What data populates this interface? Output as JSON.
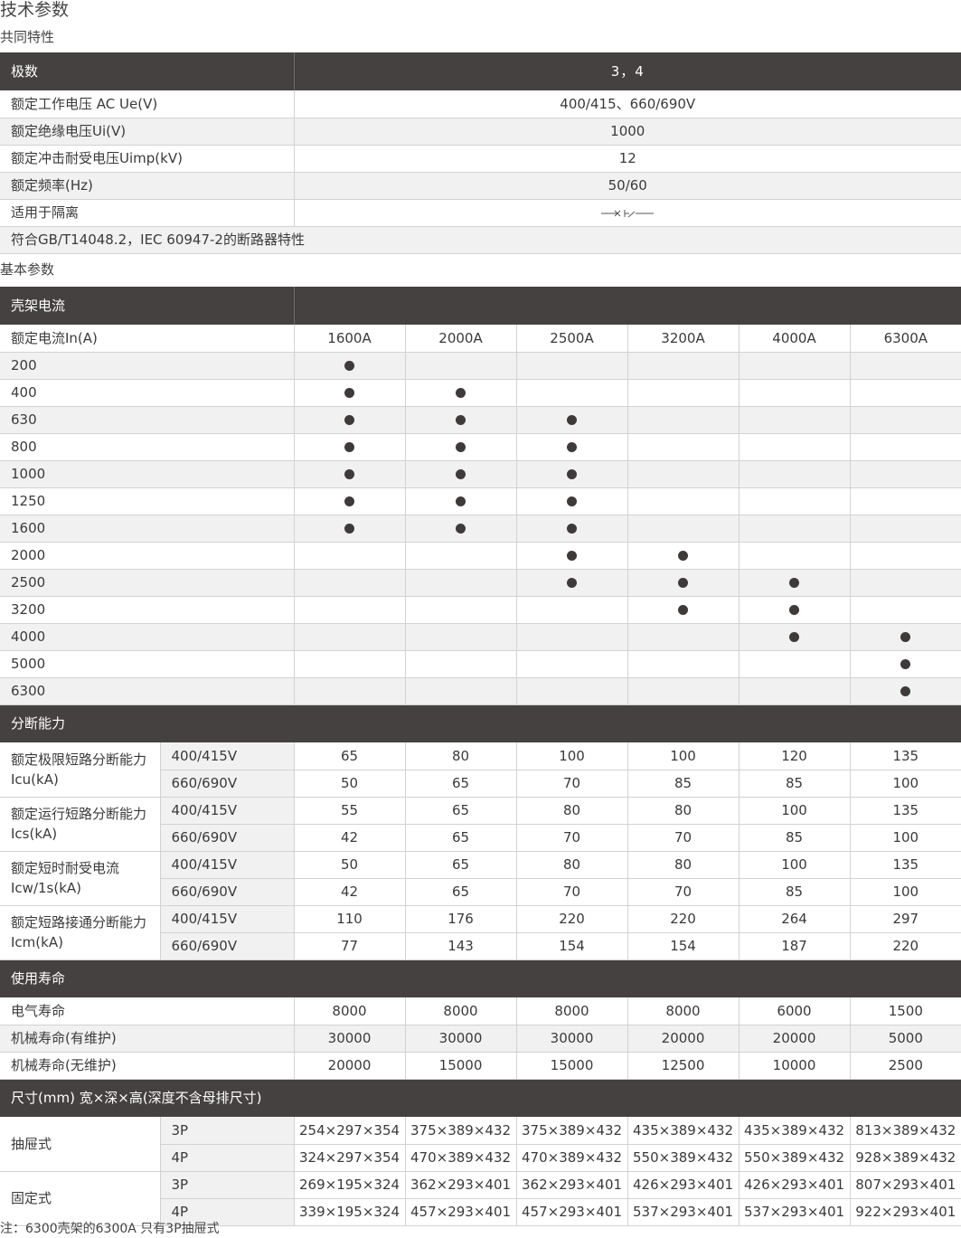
{
  "page_title": "技术参数",
  "section1": {
    "title": "共同特性",
    "header": {
      "label": "极数",
      "value": "3，4"
    },
    "rows": [
      {
        "label": "额定工作电压 AC Ue(V)",
        "value": "400/415、660/690V"
      },
      {
        "label": "额定绝缘电压Ui(V)",
        "value": "1000"
      },
      {
        "label": "额定冲击耐受电压Uimp(kV)",
        "value": "12"
      },
      {
        "label": "额定频率(Hz)",
        "value": "50/60"
      },
      {
        "label": "适用于隔离",
        "icon": "isolation-symbol-icon"
      },
      {
        "label": "符合GB/T14048.2，IEC 60947-2的断路器特性"
      }
    ]
  },
  "section2": {
    "title": "基本参数",
    "frame_header": "壳架电流",
    "rated_label": "额定电流In(A)",
    "frames": [
      "1600A",
      "2000A",
      "2500A",
      "3200A",
      "4000A",
      "6300A"
    ],
    "currents": [
      {
        "in": "200",
        "avail": [
          1,
          0,
          0,
          0,
          0,
          0
        ]
      },
      {
        "in": "400",
        "avail": [
          1,
          1,
          0,
          0,
          0,
          0
        ]
      },
      {
        "in": "630",
        "avail": [
          1,
          1,
          1,
          0,
          0,
          0
        ]
      },
      {
        "in": "800",
        "avail": [
          1,
          1,
          1,
          0,
          0,
          0
        ]
      },
      {
        "in": "1000",
        "avail": [
          1,
          1,
          1,
          0,
          0,
          0
        ]
      },
      {
        "in": "1250",
        "avail": [
          1,
          1,
          1,
          0,
          0,
          0
        ]
      },
      {
        "in": "1600",
        "avail": [
          1,
          1,
          1,
          0,
          0,
          0
        ]
      },
      {
        "in": "2000",
        "avail": [
          0,
          0,
          1,
          1,
          0,
          0
        ]
      },
      {
        "in": "2500",
        "avail": [
          0,
          0,
          1,
          1,
          1,
          0
        ]
      },
      {
        "in": "3200",
        "avail": [
          0,
          0,
          0,
          1,
          1,
          0
        ]
      },
      {
        "in": "4000",
        "avail": [
          0,
          0,
          0,
          0,
          1,
          1
        ]
      },
      {
        "in": "5000",
        "avail": [
          0,
          0,
          0,
          0,
          0,
          1
        ]
      },
      {
        "in": "6300",
        "avail": [
          0,
          0,
          0,
          0,
          0,
          1
        ]
      }
    ],
    "breaking_header": "分断能力",
    "breaking": [
      {
        "label": "额定极限短路分断能力Icu(kA)",
        "rows": [
          {
            "v": "400/415V",
            "vals": [
              "65",
              "80",
              "100",
              "100",
              "120",
              "135"
            ]
          },
          {
            "v": "660/690V",
            "vals": [
              "50",
              "65",
              "70",
              "85",
              "85",
              "100"
            ]
          }
        ]
      },
      {
        "label": "额定运行短路分断能力Ics(kA)",
        "rows": [
          {
            "v": "400/415V",
            "vals": [
              "55",
              "65",
              "80",
              "80",
              "100",
              "135"
            ]
          },
          {
            "v": "660/690V",
            "vals": [
              "42",
              "65",
              "70",
              "70",
              "85",
              "100"
            ]
          }
        ]
      },
      {
        "label": "额定短时耐受电流Icw/1s(kA)",
        "rows": [
          {
            "v": "400/415V",
            "vals": [
              "50",
              "65",
              "80",
              "80",
              "100",
              "135"
            ]
          },
          {
            "v": "660/690V",
            "vals": [
              "42",
              "65",
              "70",
              "70",
              "85",
              "100"
            ]
          }
        ]
      },
      {
        "label": "额定短路接通分断能力Icm(kA)",
        "rows": [
          {
            "v": "400/415V",
            "vals": [
              "110",
              "176",
              "220",
              "220",
              "264",
              "297"
            ]
          },
          {
            "v": "660/690V",
            "vals": [
              "77",
              "143",
              "154",
              "154",
              "187",
              "220"
            ]
          }
        ]
      }
    ],
    "life_header": "使用寿命",
    "life": [
      {
        "label": "电气寿命",
        "vals": [
          "8000",
          "8000",
          "8000",
          "8000",
          "6000",
          "1500"
        ]
      },
      {
        "label": "机械寿命(有维护)",
        "vals": [
          "30000",
          "30000",
          "30000",
          "20000",
          "20000",
          "5000"
        ]
      },
      {
        "label": "机械寿命(无维护)",
        "vals": [
          "20000",
          "15000",
          "15000",
          "12500",
          "10000",
          "2500"
        ]
      }
    ],
    "dim_header": "尺寸(mm) 宽×深×高(深度不含母排尺寸)",
    "dims": [
      {
        "label": "抽屉式",
        "rows": [
          {
            "p": "3P",
            "vals": [
              "254×297×354",
              "375×389×432",
              "375×389×432",
              "435×389×432",
              "435×389×432",
              "813×389×432"
            ]
          },
          {
            "p": "4P",
            "vals": [
              "324×297×354",
              "470×389×432",
              "470×389×432",
              "550×389×432",
              "550×389×432",
              "928×389×432"
            ]
          }
        ]
      },
      {
        "label": "固定式",
        "rows": [
          {
            "p": "3P",
            "vals": [
              "269×195×324",
              "362×293×401",
              "362×293×401",
              "426×293×401",
              "426×293×401",
              "807×293×401"
            ]
          },
          {
            "p": "4P",
            "vals": [
              "339×195×324",
              "457×293×401",
              "457×293×401",
              "537×293×401",
              "537×293×401",
              "922×293×401"
            ]
          }
        ]
      }
    ]
  },
  "note": "注：6300壳架的6300A 只有3P抽屉式"
}
